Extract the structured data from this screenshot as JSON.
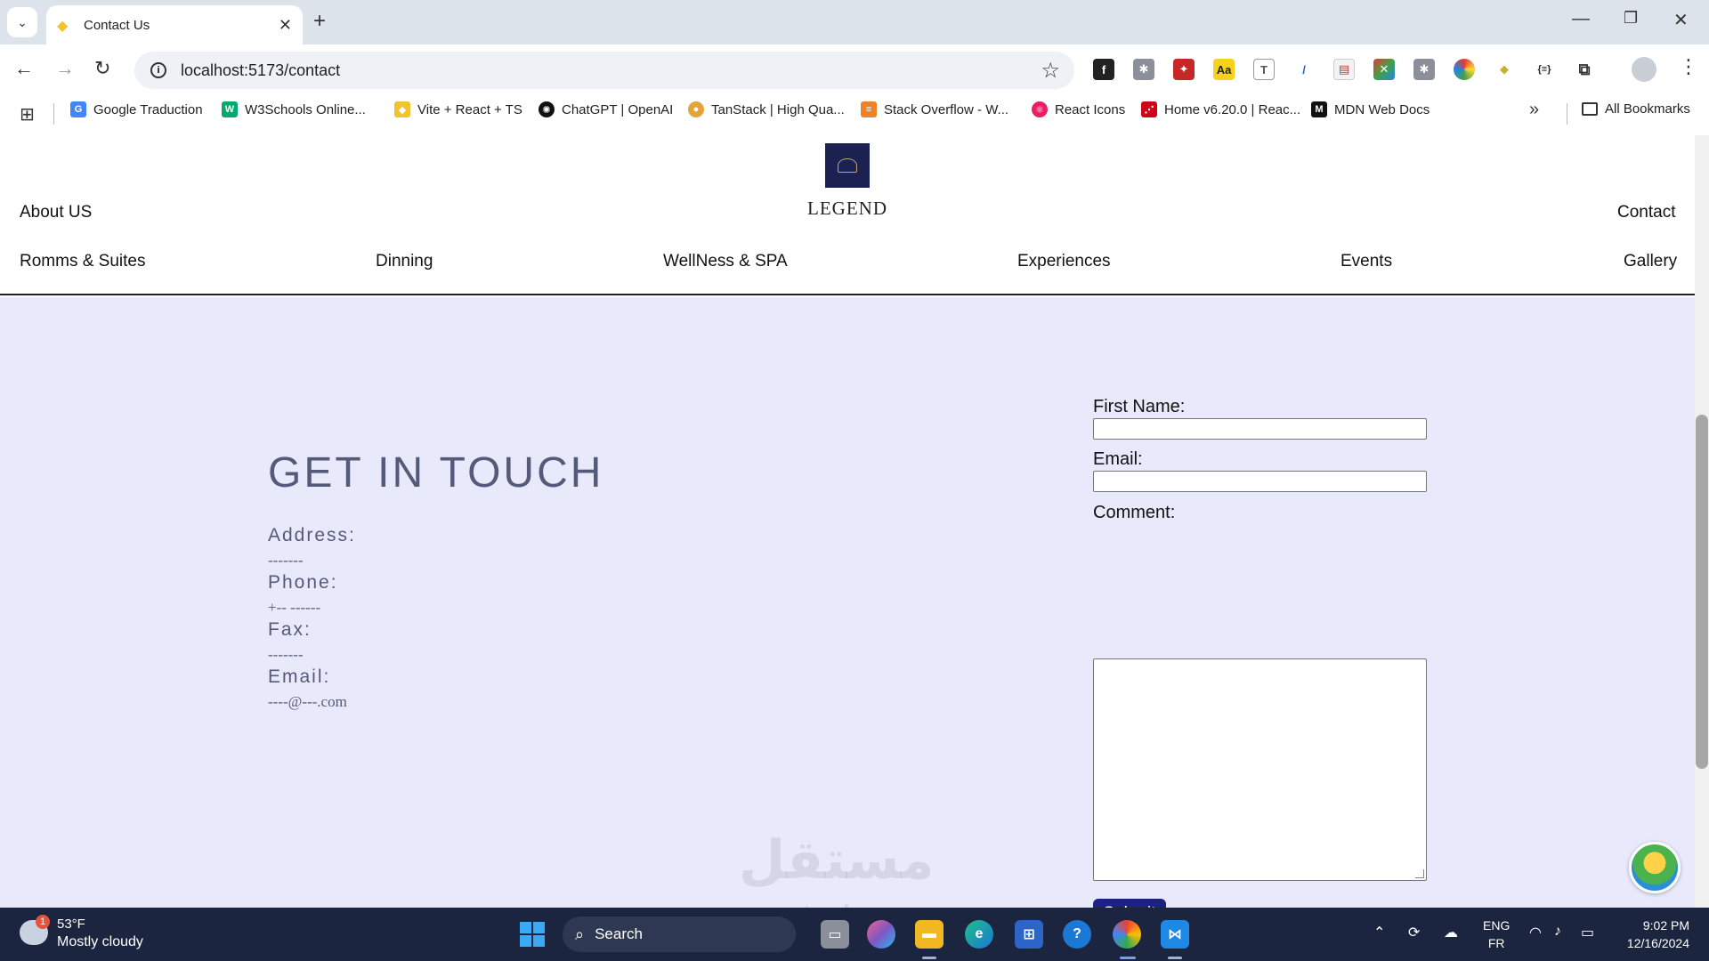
{
  "browser": {
    "tab_title": "Contact Us",
    "url": "localhost:5173/contact",
    "bookmarks": [
      {
        "label": "Google Traduction",
        "color": "#4285f4"
      },
      {
        "label": "W3Schools Online...",
        "color": "#04aa6d"
      },
      {
        "label": "Vite + React + TS",
        "color": "#f2c230"
      },
      {
        "label": "ChatGPT | OpenAI",
        "color": "#111111"
      },
      {
        "label": "TanStack | High Qua...",
        "color": "#e3a53b"
      },
      {
        "label": "Stack Overflow - W...",
        "color": "#f48024"
      },
      {
        "label": "React Icons",
        "color": "#e91e63"
      },
      {
        "label": "Home v6.20.0 | Reac...",
        "color": "#d0021b"
      },
      {
        "label": "MDN Web Docs",
        "color": "#111111"
      }
    ],
    "all_bookmarks": "All Bookmarks"
  },
  "site": {
    "logo_text": "LEGEND",
    "nav_top": {
      "about": "About US",
      "contact": "Contact"
    },
    "nav_main": [
      "Romms & Suites",
      "Dinning",
      "WellNess & SPA",
      "Experiences",
      "Events",
      "Gallery"
    ]
  },
  "contact": {
    "title": "GET IN TOUCH",
    "address_label": "Address:",
    "address_value": "-------",
    "phone_label": "Phone:",
    "phone_value": "+--  ------",
    "fax_label": "Fax:",
    "fax_value": "-------",
    "email_label": "Email:",
    "email_value": "----@---.com"
  },
  "form": {
    "first_name_label": "First Name:",
    "first_name_value": "",
    "email_label": "Email:",
    "email_value": "",
    "comment_label": "Comment:",
    "comment_value": "",
    "submit_label": "Submit"
  },
  "watermark": {
    "text": "مستقل",
    "sub": "mostaql.com"
  },
  "taskbar": {
    "weather_temp": "53°F",
    "weather_desc": "Mostly cloudy",
    "weather_badge": "1",
    "search_label": "Search",
    "lang_primary": "ENG",
    "lang_secondary": "FR",
    "time": "9:02 PM",
    "date": "12/16/2024"
  }
}
